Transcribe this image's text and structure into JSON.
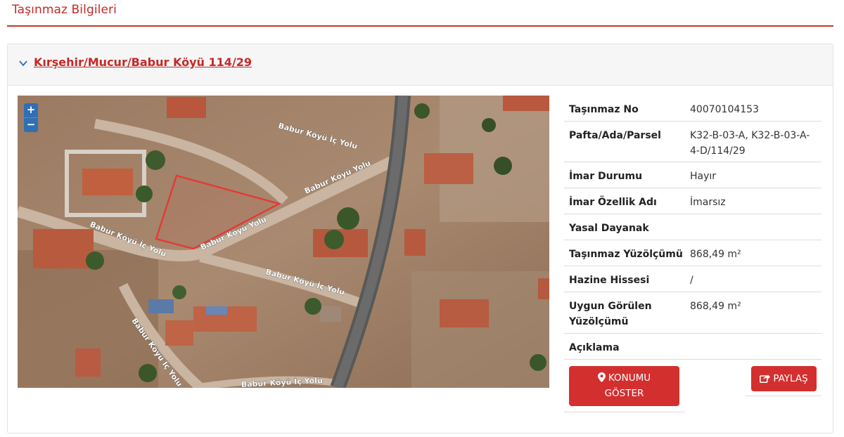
{
  "page": {
    "title": "Taşınmaz Bilgileri"
  },
  "parcel": {
    "heading": "Kırşehir/Mucur/Babur Köyü 114/29"
  },
  "map": {
    "zoom_in": "+",
    "zoom_out": "−",
    "road_labels": [
      "Babur Köyü İç Yolu",
      "Babur Köyü Yolu",
      "Babur Köyü İç Yolu",
      "Babur Köyü Yolu",
      "Babur Köyü İç Yolu",
      "Babur Köyü İç Yolu",
      "Babur Köyü İç Yolu"
    ],
    "parcel_outline_color": "#e53935"
  },
  "details": [
    {
      "key": "Taşınmaz No",
      "value": "40070104153"
    },
    {
      "key": "Pafta/Ada/Parsel",
      "value": "K32-B-03-A, K32-B-03-A-4-D/114/29"
    },
    {
      "key": "İmar Durumu",
      "value": "Hayır"
    },
    {
      "key": "İmar Özellik Adı",
      "value": "İmarsız"
    },
    {
      "key": "Yasal Dayanak",
      "value": ""
    },
    {
      "key": "Taşınmaz Yüzölçümü",
      "value": "868,49 m²"
    },
    {
      "key": "Hazine Hissesi",
      "value": "/"
    },
    {
      "key": "Uygun Görülen Yüzölçümü",
      "value": "868,49 m²"
    },
    {
      "key": "Açıklama",
      "value": ""
    }
  ],
  "actions": {
    "show_location_line1": "KONUMU",
    "show_location_line2": "GÖSTER",
    "share": "PAYLAŞ"
  },
  "colors": {
    "accent": "#c62828",
    "button": "#d32f2f",
    "zoom": "#2f6fb5"
  }
}
